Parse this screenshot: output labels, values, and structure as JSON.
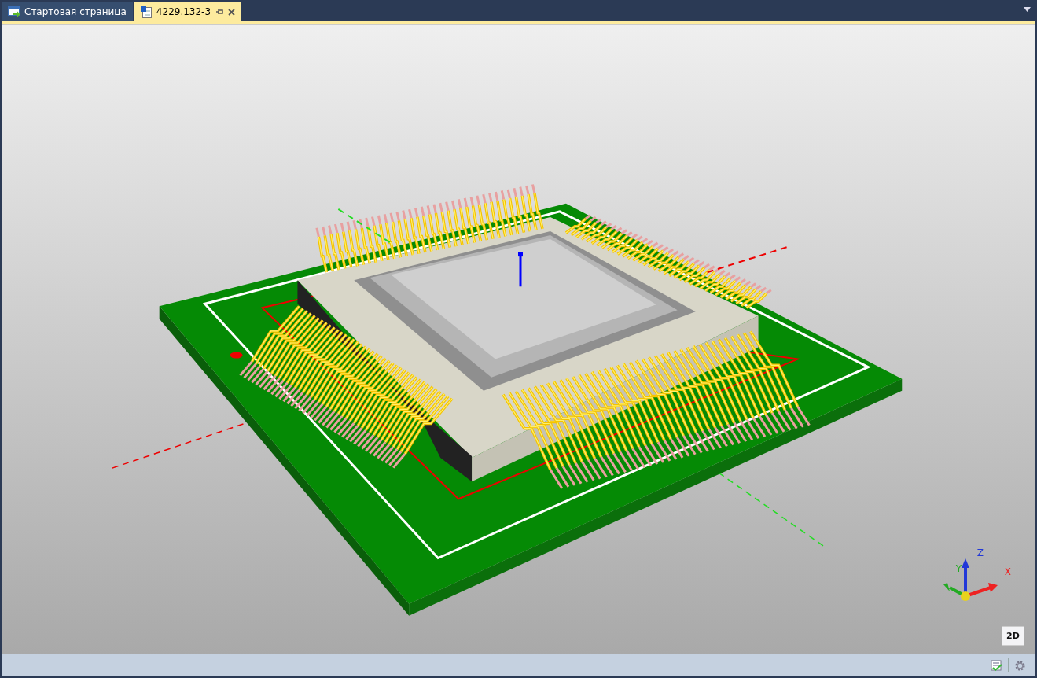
{
  "tabs": [
    {
      "label": "Стартовая страница",
      "kind": "start",
      "selected": false
    },
    {
      "label": "4229.132-3",
      "kind": "document",
      "selected": true
    }
  ],
  "viewport": {
    "axis_labels": {
      "x": "X",
      "y": "Y",
      "z": "Z"
    },
    "view_button": "2D"
  }
}
